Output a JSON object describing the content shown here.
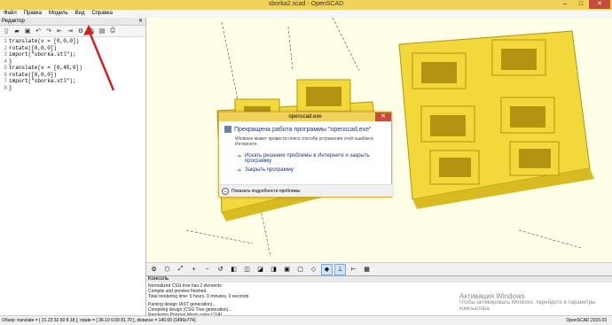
{
  "window": {
    "title": "sborka2.scad - OpenSCAD"
  },
  "menu": [
    "Файл",
    "Правка",
    "Модель",
    "Вид",
    "Справка"
  ],
  "editor": {
    "title": "Редактор",
    "code_lines": [
      "translate(v = [0,0,0])",
      "rotate([0,0,0])",
      "  import(\"sborka.stl\");",
      "}",
      "translate(v = [0,45,0])",
      "rotate([0,0,0])",
      "  import(\"sborka.stl\");",
      "}"
    ]
  },
  "console": {
    "title": "Консоль",
    "lines": [
      "Normalized CSG tree has 2 elements",
      "Compile and preview finished.",
      "Total rendering time: 0 hours, 0 minutes, 0 seconds",
      "",
      "Parsing design (AST generation)...",
      "Compiling design (CSG Tree generation)...",
      "Rendering Polygon Mesh using CGAL..."
    ]
  },
  "dialog": {
    "title": "openscad.exe",
    "heading": "Прекращена работа программы \"openscad.exe\"",
    "description": "Windows может провести поиск способа устранения этой ошибки в Интернете.",
    "option1": "Искать решение проблемы в Интернете и закрыть программу",
    "option2": "Закрыть программу",
    "details": "Показать подробности проблемы"
  },
  "status": {
    "left": "Обзор: translate = [ 21.23 32.50 8.18 ], rotate = [ 36.10 0.00 81.70 ], distance = 140.00 (1496x774)",
    "right": "OpenSCAD 2015.03"
  },
  "watermark": {
    "title": "Активация Windows",
    "sub1": "Чтобы активировать Windows, перейдите в параметры",
    "sub2": "компьютера."
  },
  "colors": {
    "model": "#f3d83c",
    "model_dark": "#b39412",
    "viewport_bg": "#ffffe8",
    "titlebar": "#f0d25a",
    "close": "#c74c3c",
    "arrow": "#d02020"
  }
}
